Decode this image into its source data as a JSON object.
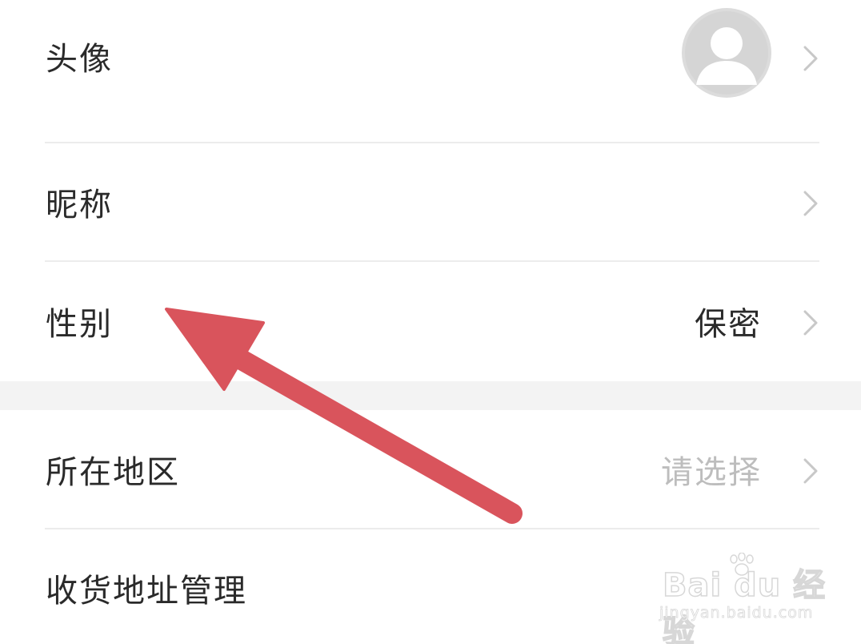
{
  "rows": [
    {
      "label": "头像",
      "value": ""
    },
    {
      "label": "昵称",
      "value": ""
    },
    {
      "label": "性别",
      "value": "保密"
    },
    {
      "label": "所在地区",
      "value": "请选择"
    },
    {
      "label": "收货地址管理",
      "value": ""
    }
  ],
  "icons": {
    "avatar": "default-avatar-icon",
    "chevron": "chevron-right-icon",
    "annotation": "red-arrow-annotation"
  },
  "watermark": {
    "logo": "Bai du 经验",
    "url": "jingyan.baidu.com"
  },
  "colors": {
    "label": "#2a2a2a",
    "value_set": "#2a2a2a",
    "value_placeholder": "#bdbdbd",
    "chevron": "#c8c8c8",
    "divider": "#ececec",
    "section_gap": "#f3f3f3",
    "arrow": "#d9545c"
  }
}
